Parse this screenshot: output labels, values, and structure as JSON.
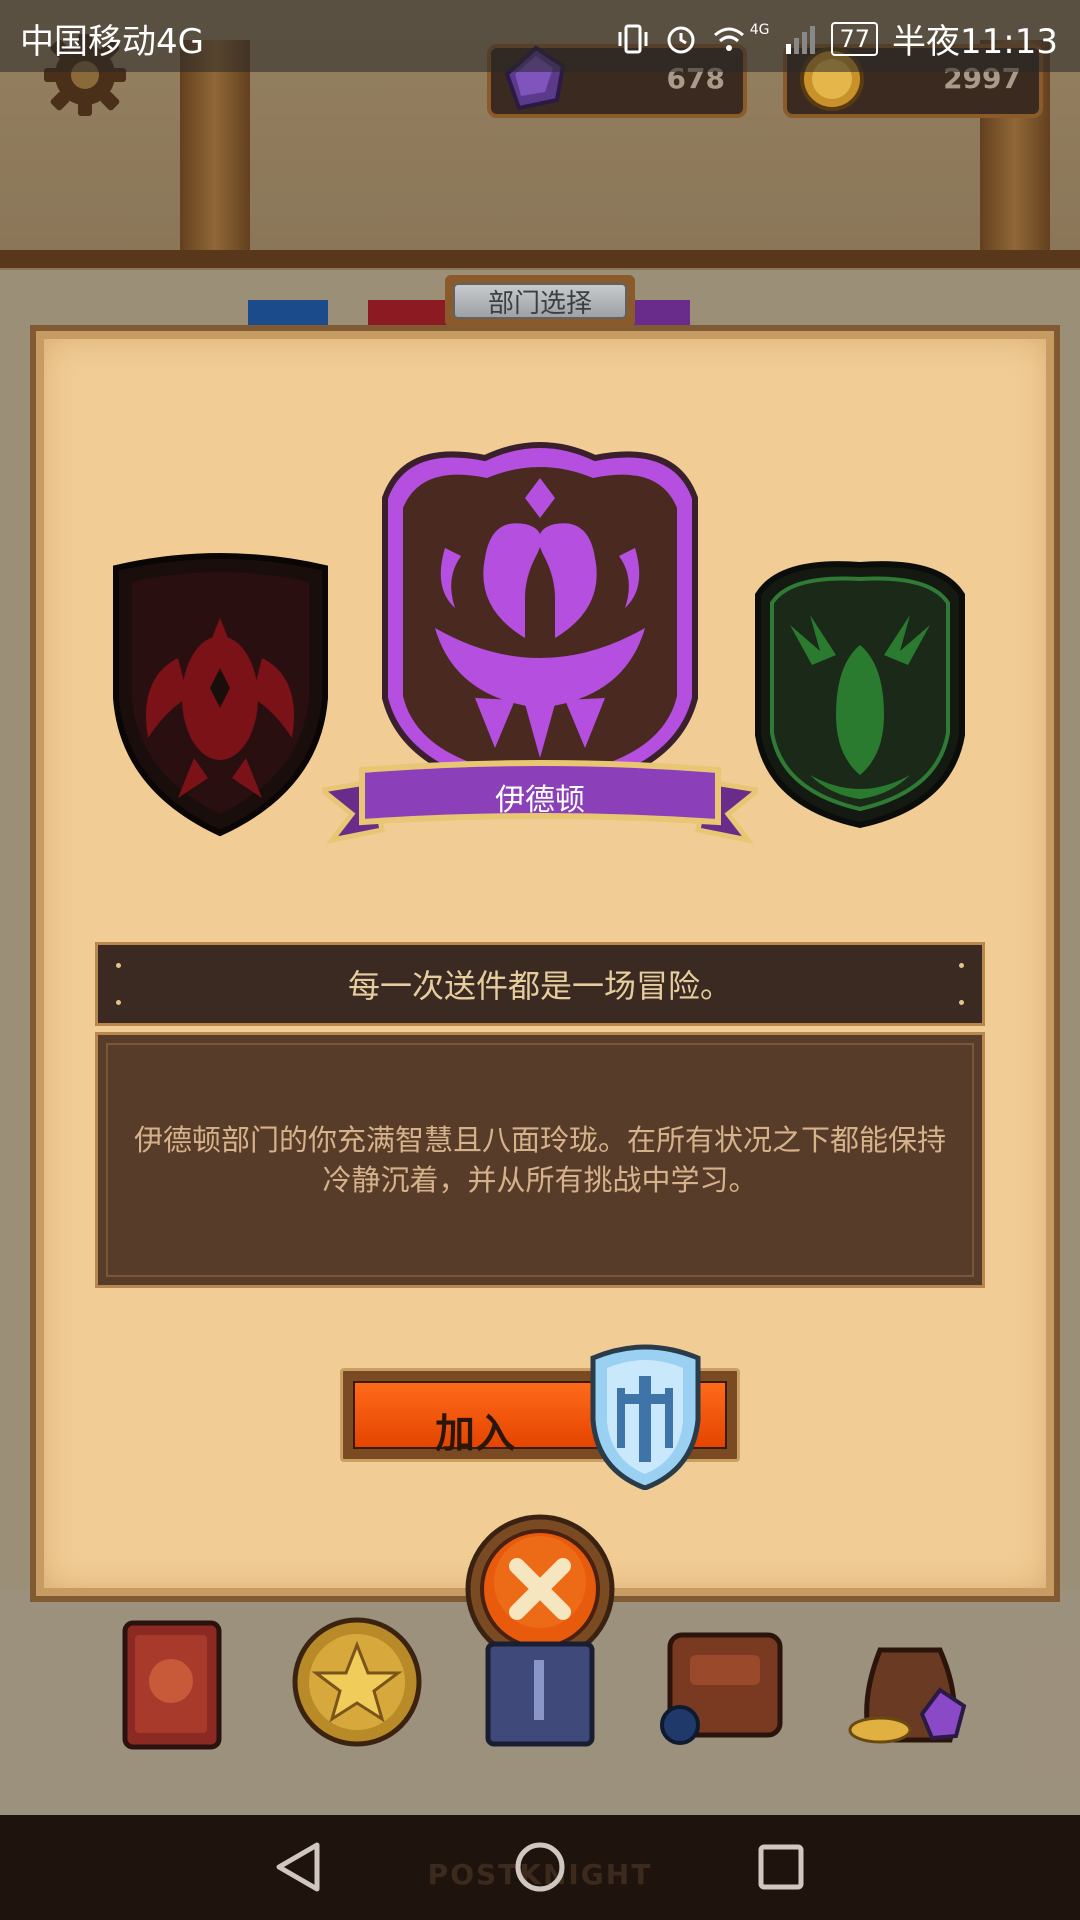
{
  "status_bar": {
    "carrier": "中国移动4G",
    "network_badge": "4G",
    "battery": "77",
    "time": "半夜11:13",
    "icons": [
      "vibrate-icon",
      "alarm-icon",
      "wifi-icon",
      "signal-icon",
      "battery-icon"
    ]
  },
  "header": {
    "gems": "678",
    "coins": "2997",
    "icons": [
      "gear-icon",
      "gem-icon",
      "coin-icon"
    ]
  },
  "dialog": {
    "title": "部门选择",
    "selected_department": "伊德顿",
    "motto": "每一次送件都是一场冒险。",
    "description": "伊德顿部门的你充满智慧且八面玲珑。在所有状况之下都能保持冷静沉着，并从所有挑战中学习。",
    "join_button": "加入",
    "emblems": [
      "red-dragon-emblem",
      "purple-swan-emblem",
      "green-stag-emblem"
    ]
  },
  "bottom_bar": {
    "items": [
      "book-icon",
      "star-coin-icon",
      "card-icon",
      "backpack-icon",
      "loot-bag-icon"
    ],
    "watermark": "POSTKNIGHT"
  },
  "nav_bar": {
    "icons": [
      "back-icon",
      "home-icon",
      "recents-icon"
    ]
  },
  "colors": {
    "panel": "#f1cd95",
    "accent_purple": "#b44fe0",
    "join_orange": "#ff5a00",
    "motto_bg": "#3a2a22",
    "desc_bg": "#573c29"
  }
}
